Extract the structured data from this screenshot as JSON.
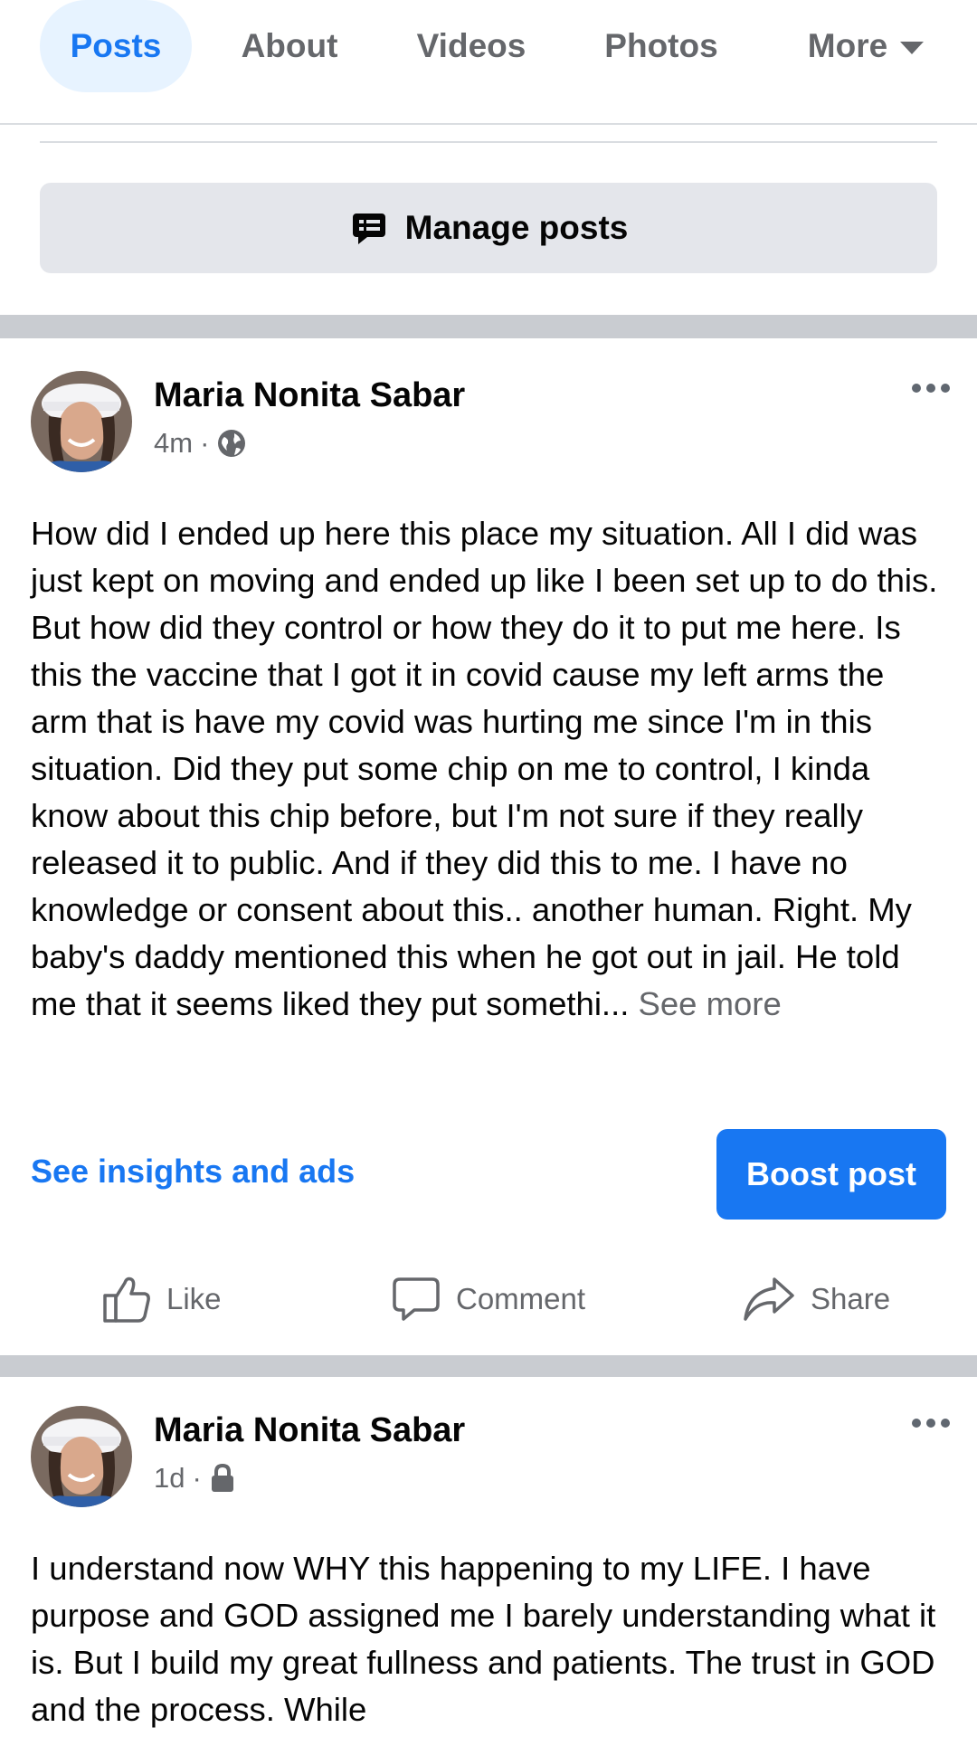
{
  "tabs": {
    "posts": "Posts",
    "about": "About",
    "videos": "Videos",
    "photos": "Photos",
    "more": "More"
  },
  "manage_posts_label": "Manage posts",
  "posts": [
    {
      "author": "Maria Nonita Sabar",
      "time": "4m",
      "audience_icon": "globe-icon",
      "body": "How did I ended up here this place my situation. All I did was just kept on moving and ended up like I been set up to do this. But how did they control or how they do it to put me here. Is this the vaccine that I got it in covid cause my left arms the arm that is have my covid was hurting me since I'm in this situation. Did they put some chip on me to control, I kinda know about this chip before, but I'm not sure if they really released it to public. And if they did this to me. I have no knowledge or consent about this..  another human. Right. My baby's daddy mentioned this when he got out in jail. He told me that it seems liked they put somethi...",
      "see_more": "See more",
      "insights_label": "See insights and ads",
      "boost_label": "Boost post",
      "like_label": "Like",
      "comment_label": "Comment",
      "share_label": "Share"
    },
    {
      "author": "Maria Nonita Sabar",
      "time": "1d",
      "audience_icon": "lock-icon",
      "body": "I understand now WHY this  happening to my LIFE. I have purpose and GOD assigned me I barely understanding what it is. But  I build my great fullness and patients. The trust in GOD and the process. While"
    }
  ],
  "colors": {
    "accent": "#1877f2",
    "active_tab_bg": "#e7f3ff",
    "button_gray": "#e4e6eb",
    "separator": "#c9ccd1",
    "secondary_text": "#65676b"
  }
}
